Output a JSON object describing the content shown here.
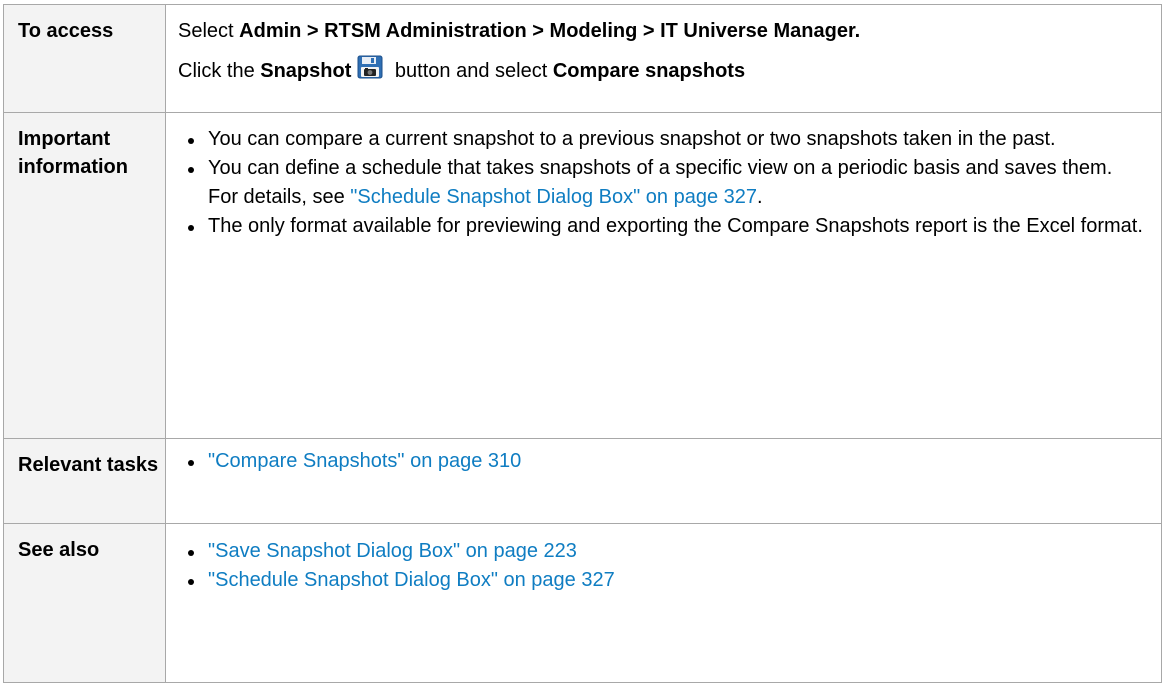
{
  "rows": {
    "access": {
      "label": "To access",
      "line1": {
        "prefix": "Select ",
        "path": "Admin > RTSM Administration > Modeling > IT Universe Manager."
      },
      "line2": {
        "prefix": "Click the ",
        "button_name": "Snapshot",
        "icon": "snapshot-icon",
        "middle": " button and select ",
        "action": "Compare snapshots"
      }
    },
    "important": {
      "label": "Important information",
      "bullets": [
        {
          "text": "You can compare a current snapshot to a previous snapshot or two snapshots taken in the past."
        },
        {
          "text": "You can define a schedule that takes snapshots of a specific view on a periodic basis and saves them. For details, see ",
          "link": "\"Schedule Snapshot Dialog Box\" on page 327",
          "suffix": "."
        },
        {
          "text": "The only format available for previewing and exporting the Compare Snapshots report is the Excel format."
        }
      ]
    },
    "tasks": {
      "label": "Relevant tasks",
      "bullets": [
        {
          "link": "\"Compare Snapshots\" on page 310"
        }
      ]
    },
    "see_also": {
      "label": "See also",
      "bullets": [
        {
          "link": "\"Save Snapshot Dialog Box\" on page 223"
        },
        {
          "link": "\"Schedule Snapshot Dialog Box\" on page 327"
        }
      ]
    }
  },
  "colors": {
    "link": "#0f7dc2",
    "label_background": "#f3f3f3",
    "border": "#a8a8a8"
  }
}
